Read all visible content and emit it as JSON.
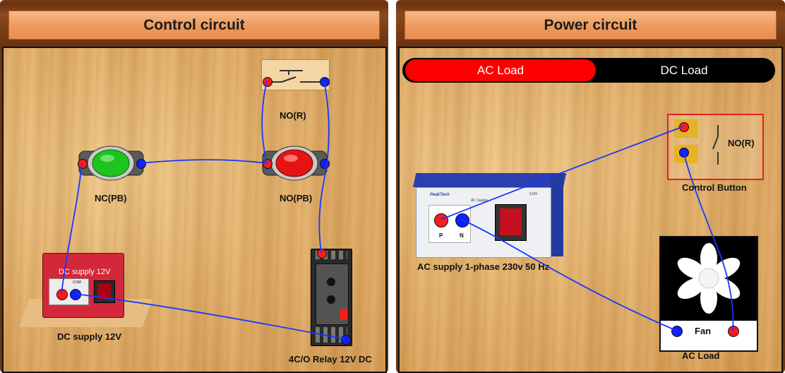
{
  "control_panel": {
    "title": "Control circuit",
    "labels": {
      "no_r": "NO(R)",
      "nc_pb": "NC(PB)",
      "no_pb": "NO(PB)",
      "dc_supply": "DC supply 12V",
      "dc_supply_face": "DC supply 12V",
      "com": "COM",
      "relay": "4C/O Relay 12V DC"
    }
  },
  "power_panel": {
    "title": "Power circuit",
    "toggle": {
      "ac_label": "AC Load",
      "dc_label": "DC Load",
      "selected": "AC Load"
    },
    "labels": {
      "no_r": "NO(R)",
      "control_button": "Control Button",
      "ac_supply": "AC supply 1-phase 230v 50 Hz",
      "fan": "Fan",
      "ac_load": "AC Load",
      "p": "P",
      "n": "N",
      "brand": "PeakTech",
      "supply_tag": "AC Supply",
      "model": "5195"
    }
  },
  "colors": {
    "wire": "#1638ff",
    "terminal_red": "#ff1a1a",
    "terminal_blue": "#1020ff",
    "toggle_active": "#ff0000",
    "toggle_bg": "#000000"
  }
}
